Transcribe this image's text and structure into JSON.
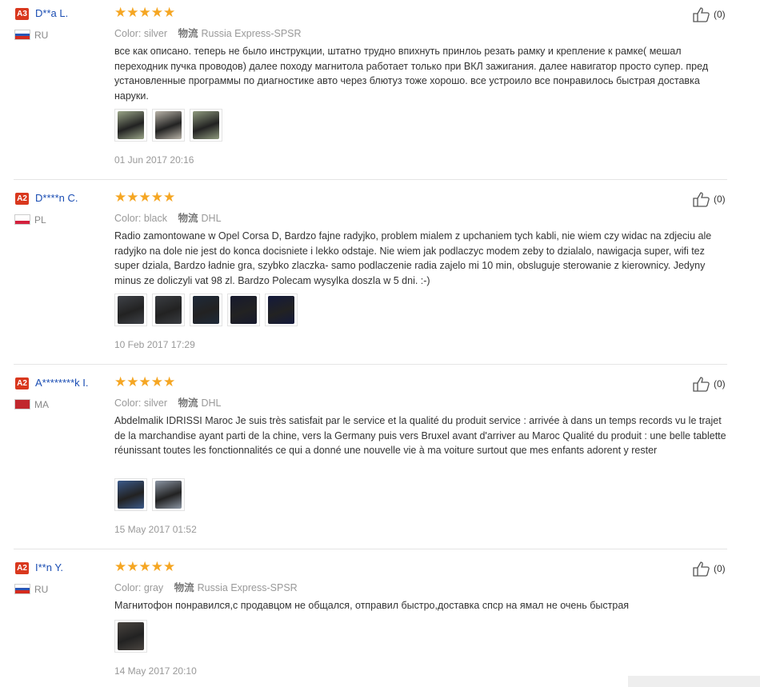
{
  "reviews": [
    {
      "level": "A3",
      "buyer": "D**a L.",
      "country": "RU",
      "flag": [
        "#ffffff",
        "#2856b6",
        "#d52b1e"
      ],
      "stars": "★★★★★",
      "color_label": "Color:",
      "color_value": "silver",
      "shipping_label": "物流",
      "shipping_value": "Russia Express-SPSR",
      "text": "все как описано. теперь не было инструкции, штатно трудно впихнуть принлоь резать рамку и крепление к рамке( мешал переходник пучка проводов) далее походу магнитола работает только при ВКЛ зажигания. далее навигатор просто супер. пред установленные программы по диагностике авто через блютуз тоже хорошо. все устроило все понравилось быстрая доставка наруки.",
      "photos": [
        "#9aa588",
        "#b9b3a8",
        "#8f9a7e"
      ],
      "date": "01 Jun 2017 20:16",
      "helpful": "(0)"
    },
    {
      "level": "A2",
      "buyer": "D****n C.",
      "country": "PL",
      "flag": [
        "#ffffff",
        "#ffffff",
        "#d4213d"
      ],
      "stars": "★★★★★",
      "color_label": "Color:",
      "color_value": "black",
      "shipping_label": "物流",
      "shipping_value": "DHL",
      "text": "Radio zamontowane w Opel Corsa D, Bardzo fajne radyjko, problem mialem z upchaniem tych kabli, nie wiem czy widac na zdjeciu ale radyjko na dole nie jest do konca docisniete i lekko odstaje. Nie wiem jak podlaczyc modem zeby to dzialalo, nawigacja super, wifi tez super dziala, Bardzo ładnie gra, szybko zlaczka- samo podlaczenie radia zajelo mi 10 min, obsluguje sterowanie z kierownicy. Jedyny minus ze doliczyli vat 98 zl. Bardzo Polecam wysylka doszla w 5 dni. :-)",
      "photos": [
        "#3f4248",
        "#3a3d42",
        "#1f2a3a",
        "#171a2e",
        "#141a3c"
      ],
      "date": "10 Feb 2017 17:29",
      "helpful": "(0)"
    },
    {
      "level": "A2",
      "buyer": "A********k I.",
      "country": "MA",
      "flag": [
        "#c1272d",
        "#c1272d",
        "#c1272d"
      ],
      "stars": "★★★★★",
      "color_label": "Color:",
      "color_value": "silver",
      "shipping_label": "物流",
      "shipping_value": "DHL",
      "text": "Abdelmalik IDRISSI Maroc Je suis très satisfait par le service et la qualité du produit service : arrivée à dans un temps records vu le trajet de la marchandise ayant parti de la chine, vers la Germany puis vers Bruxel avant d'arriver au Maroc Qualité du produit : une belle tablette réunissant toutes les fonctionnalités ce qui a donné une nouvelle vie à ma voiture surtout que mes enfants adorent y rester",
      "photos": [
        "#3b5a8a",
        "#8b95a3"
      ],
      "date": "15 May 2017 01:52",
      "helpful": "(0)"
    },
    {
      "level": "A2",
      "buyer": "I**n Y.",
      "country": "RU",
      "flag": [
        "#ffffff",
        "#2856b6",
        "#d52b1e"
      ],
      "stars": "★★★★★",
      "color_label": "Color:",
      "color_value": "gray",
      "shipping_label": "物流",
      "shipping_value": "Russia Express-SPSR",
      "text": "Магнитофон понравился,с продавцом не общался, отправил быстро,доставка спср на ямал не очень быстрая",
      "photos": [
        "#4a4540"
      ],
      "date": "14 May 2017 20:10",
      "helpful": "(0)"
    }
  ]
}
